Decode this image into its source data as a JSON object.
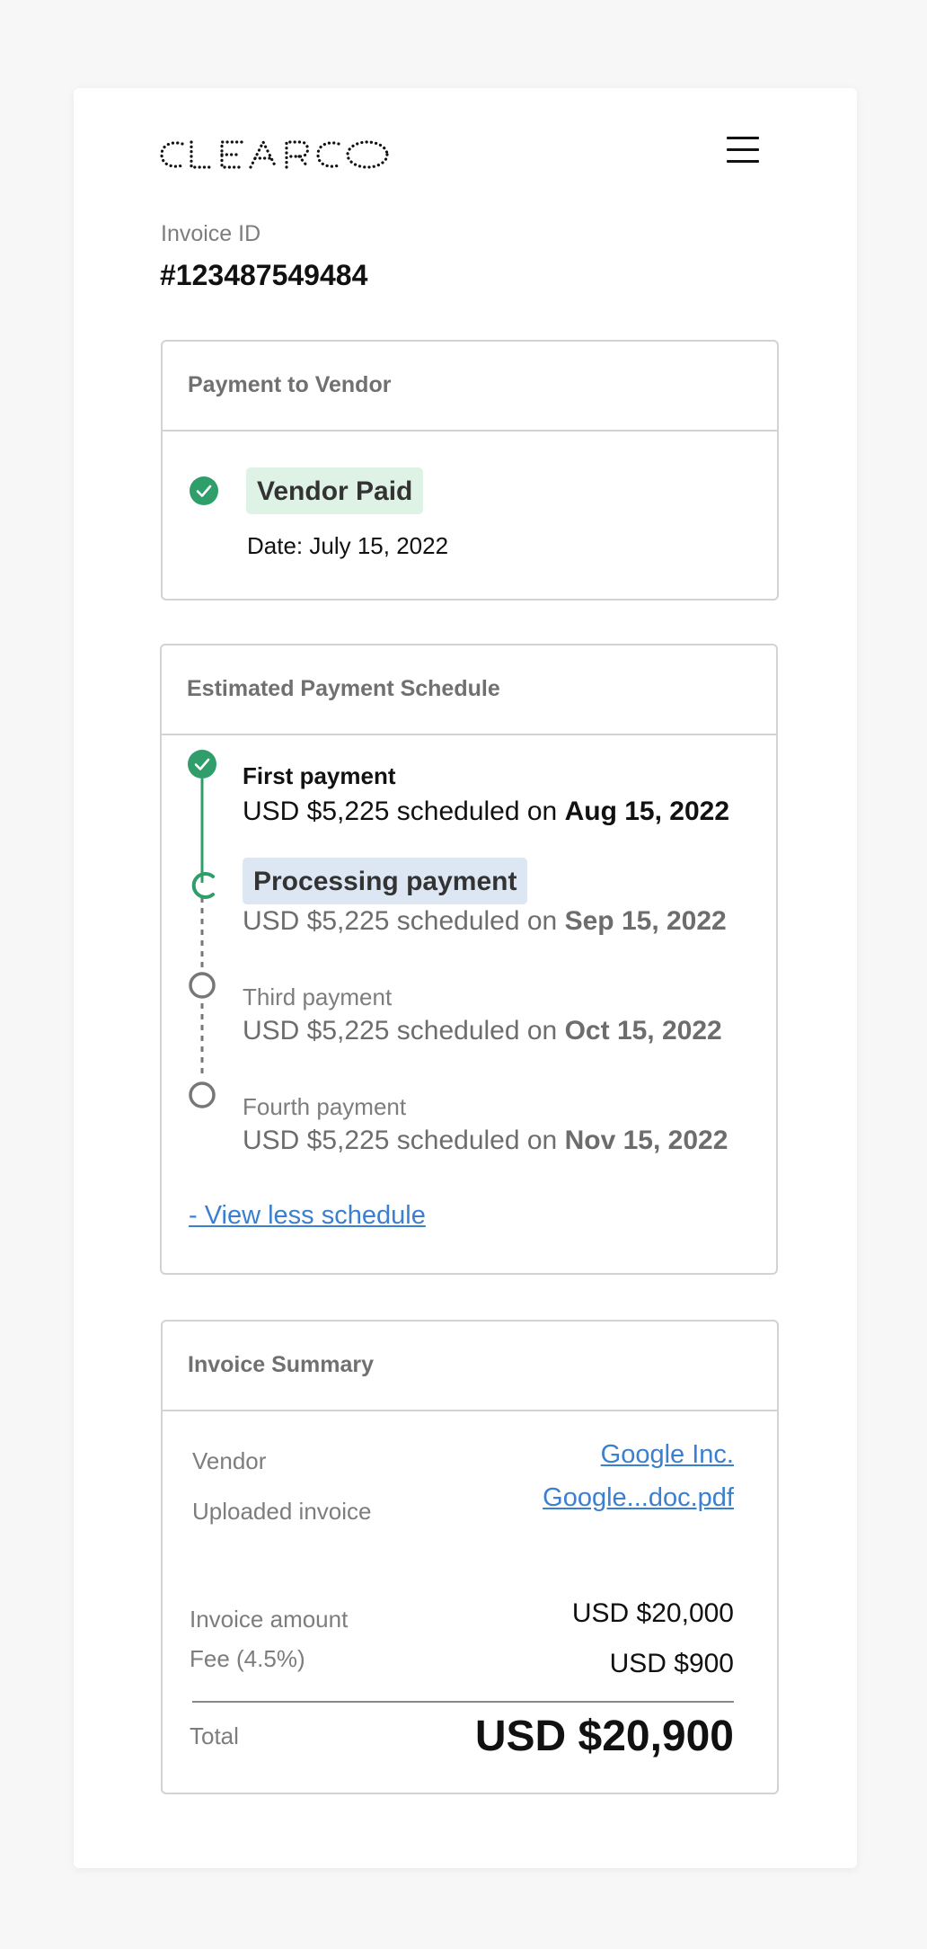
{
  "brand": {
    "logo_text": "CLEARCO"
  },
  "header": {
    "menu_icon": "hamburger-menu-icon"
  },
  "invoice": {
    "id_label": "Invoice ID",
    "id_value": "#123487549484"
  },
  "payment_to_vendor": {
    "title": "Payment to Vendor",
    "status_label": "Vendor Paid",
    "date_text": "Date: July 15, 2022",
    "status_color": "#2f9e6a"
  },
  "schedule": {
    "title": "Estimated Payment Schedule",
    "items": [
      {
        "title": "First payment",
        "prefix": "USD $5,225 scheduled on ",
        "date": "Aug 15, 2022",
        "state": "completed"
      },
      {
        "title": "Processing payment",
        "prefix": "USD $5,225 scheduled on ",
        "date": "Sep 15, 2022",
        "state": "processing"
      },
      {
        "title": "Third payment",
        "prefix": "USD $5,225 scheduled on ",
        "date": "Oct 15, 2022",
        "state": "upcoming"
      },
      {
        "title": "Fourth payment",
        "prefix": "USD $5,225 scheduled on ",
        "date": "Nov 15, 2022",
        "state": "upcoming"
      }
    ],
    "toggle_label": "- View less schedule"
  },
  "summary": {
    "title": "Invoice Summary",
    "vendor_label": "Vendor",
    "vendor_value": "Google Inc.",
    "uploaded_label": "Uploaded invoice",
    "uploaded_value": "Google...doc.pdf",
    "amount_label": "Invoice amount",
    "amount_value": "USD $20,000",
    "fee_label": "Fee (4.5%)",
    "fee_value": "USD $900",
    "total_label": "Total",
    "total_value": "USD $20,900"
  },
  "colors": {
    "accent_green": "#2f9e6a",
    "link_blue": "#3a7fd0",
    "badge_green_bg": "#dff2e6",
    "badge_blue_bg": "#dde7f3"
  }
}
